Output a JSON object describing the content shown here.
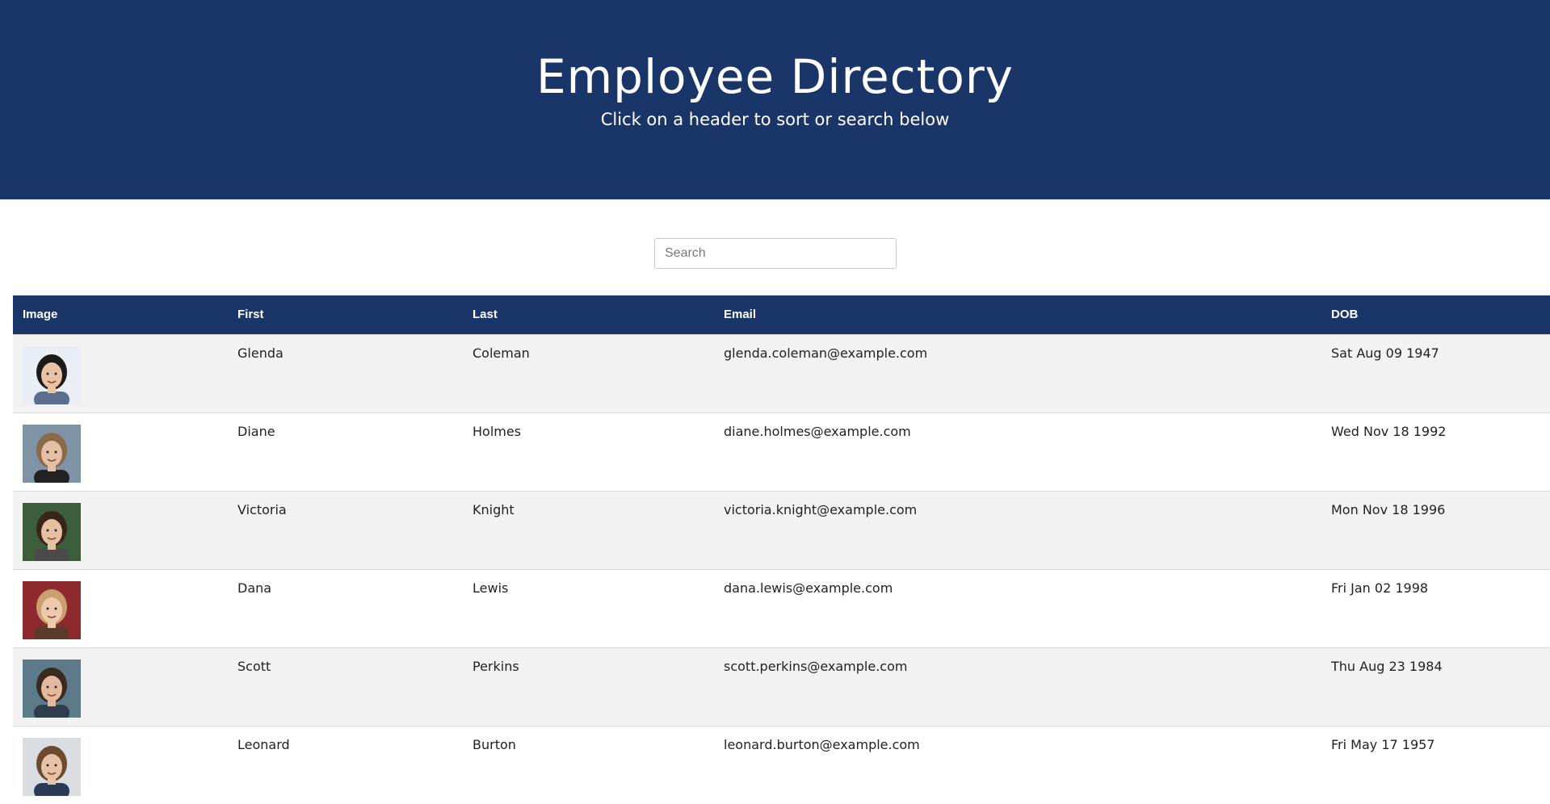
{
  "header": {
    "title": "Employee Directory",
    "subtitle": "Click on a header to sort or search below"
  },
  "search": {
    "placeholder": "Search",
    "value": ""
  },
  "table": {
    "columns": [
      "Image",
      "First",
      "Last",
      "Email",
      "DOB"
    ],
    "rows": [
      {
        "first": "Glenda",
        "last": "Coleman",
        "email": "glenda.coleman@example.com",
        "dob": "Sat Aug 09 1947",
        "avatar": {
          "bg": "#e9eef4",
          "skin": "#e8c2a3",
          "hair": "#1d1a1c",
          "shirt": "#5a6f8f"
        }
      },
      {
        "first": "Diane",
        "last": "Holmes",
        "email": "diane.holmes@example.com",
        "dob": "Wed Nov 18 1992",
        "avatar": {
          "bg": "#7e94a6",
          "skin": "#e3bfa6",
          "hair": "#8b6a4a",
          "shirt": "#222222"
        }
      },
      {
        "first": "Victoria",
        "last": "Knight",
        "email": "victoria.knight@example.com",
        "dob": "Mon Nov 18 1996",
        "avatar": {
          "bg": "#3c5e3a",
          "skin": "#e6c0a2",
          "hair": "#3a2618",
          "shirt": "#4a4a4a"
        }
      },
      {
        "first": "Dana",
        "last": "Lewis",
        "email": "dana.lewis@example.com",
        "dob": "Fri Jan 02 1998",
        "avatar": {
          "bg": "#8e2a2e",
          "skin": "#ecc9ad",
          "hair": "#caa070",
          "shirt": "#5b3a2c"
        }
      },
      {
        "first": "Scott",
        "last": "Perkins",
        "email": "scott.perkins@example.com",
        "dob": "Thu Aug 23 1984",
        "avatar": {
          "bg": "#5c7a8a",
          "skin": "#e2b99c",
          "hair": "#3b2a1e",
          "shirt": "#2e3e4e"
        }
      },
      {
        "first": "Leonard",
        "last": "Burton",
        "email": "leonard.burton@example.com",
        "dob": "Fri May 17 1957",
        "avatar": {
          "bg": "#d9dde2",
          "skin": "#e6c2a6",
          "hair": "#6b4a2e",
          "shirt": "#2b3a55"
        }
      }
    ]
  },
  "colors": {
    "primary": "#1a3668",
    "row_alt": "#f2f2f2"
  }
}
